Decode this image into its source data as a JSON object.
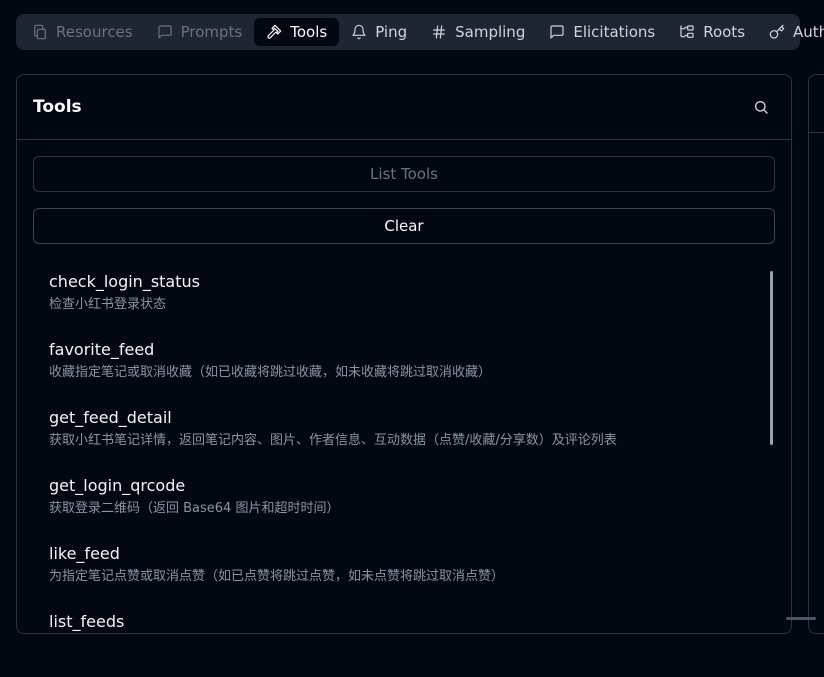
{
  "tabs": [
    {
      "label": "Resources",
      "icon": "files-icon",
      "state": "disabled"
    },
    {
      "label": "Prompts",
      "icon": "message-square-icon",
      "state": "disabled"
    },
    {
      "label": "Tools",
      "icon": "hammer-icon",
      "state": "active"
    },
    {
      "label": "Ping",
      "icon": "bell-icon",
      "state": "normal"
    },
    {
      "label": "Sampling",
      "icon": "hash-icon",
      "state": "normal"
    },
    {
      "label": "Elicitations",
      "icon": "message-square-icon",
      "state": "normal"
    },
    {
      "label": "Roots",
      "icon": "folder-tree-icon",
      "state": "normal"
    },
    {
      "label": "Auth",
      "icon": "key-icon",
      "state": "normal"
    }
  ],
  "tools_panel": {
    "title": "Tools",
    "search_icon": "search-icon",
    "list_button": "List Tools",
    "clear_button": "Clear",
    "items": [
      {
        "name": "check_login_status",
        "description": "检查小红书登录状态"
      },
      {
        "name": "favorite_feed",
        "description": "收藏指定笔记或取消收藏（如已收藏将跳过收藏，如未收藏将跳过取消收藏）"
      },
      {
        "name": "get_feed_detail",
        "description": "获取小红书笔记详情，返回笔记内容、图片、作者信息、互动数据（点赞/收藏/分享数）及评论列表"
      },
      {
        "name": "get_login_qrcode",
        "description": "获取登录二维码（返回 Base64 图片和超时时间）"
      },
      {
        "name": "like_feed",
        "description": "为指定笔记点赞或取消点赞（如已点赞将跳过点赞，如未点赞将跳过取消点赞）"
      },
      {
        "name": "list_feeds",
        "description": ""
      }
    ]
  },
  "colors": {
    "background": "#030712",
    "tabbar": "#1e2533",
    "border": "#2a3342",
    "muted_text": "#8b93a1"
  }
}
